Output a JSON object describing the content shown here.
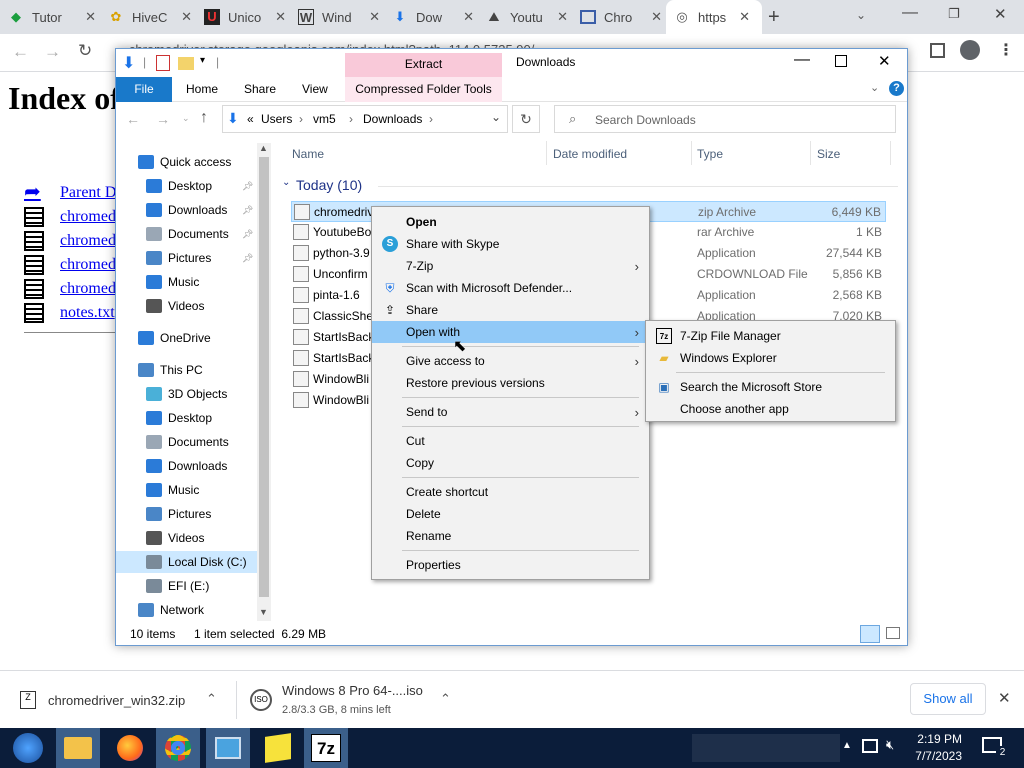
{
  "browser": {
    "tabs": [
      {
        "title": "Tutor",
        "icon": "tutorialspoint-icon"
      },
      {
        "title": "HiveC",
        "icon": "hive-icon"
      },
      {
        "title": "Unico",
        "icon": "unicode-icon"
      },
      {
        "title": "Wind",
        "icon": "wikipedia-icon"
      },
      {
        "title": "Dow",
        "icon": "download-icon"
      },
      {
        "title": "Youtu",
        "icon": "youtube-downloader-icon"
      },
      {
        "title": "Chro",
        "icon": "chrome-window-icon"
      },
      {
        "title": "https",
        "icon": "globe-icon"
      }
    ],
    "address_url": "...chromedriver.storage.googleapis.com/index.html?path=114.0.5735.90/"
  },
  "page": {
    "heading": "Index of",
    "links": [
      "Parent D",
      "chromed",
      "chromed",
      "chromed",
      "chromed",
      "notes.txt"
    ]
  },
  "explorer": {
    "title": "Downloads",
    "ribbon": {
      "extract_tab": "Extract",
      "tabs": [
        "File",
        "Home",
        "Share",
        "View",
        "Compressed Folder Tools"
      ]
    },
    "breadcrumb": [
      "«",
      "Users",
      "vm5",
      "Downloads"
    ],
    "search_placeholder": "Search Downloads",
    "columns": [
      "Name",
      "Date modified",
      "Type",
      "Size"
    ],
    "group_label": "Today (10)",
    "nav": [
      {
        "label": "Quick access",
        "icon": "star-icon",
        "color": "#2b7bd8",
        "indent": 1,
        "pinned": false
      },
      {
        "label": "Desktop",
        "icon": "desktop-icon",
        "color": "#2b7bd8",
        "indent": 2,
        "pinned": true
      },
      {
        "label": "Downloads",
        "icon": "downloads-icon",
        "color": "#2b7bd8",
        "indent": 2,
        "pinned": true
      },
      {
        "label": "Documents",
        "icon": "documents-icon",
        "color": "#9aa7b5",
        "indent": 2,
        "pinned": true
      },
      {
        "label": "Pictures",
        "icon": "pictures-icon",
        "color": "#4a86c7",
        "indent": 2,
        "pinned": true
      },
      {
        "label": "Music",
        "icon": "music-icon",
        "color": "#2b7bd8",
        "indent": 2,
        "pinned": false
      },
      {
        "label": "Videos",
        "icon": "videos-icon",
        "color": "#555555",
        "indent": 2,
        "pinned": false
      },
      {
        "label": "OneDrive",
        "icon": "onedrive-icon",
        "color": "#2b7bd8",
        "indent": 1,
        "pinned": false
      },
      {
        "label": "This PC",
        "icon": "this-pc-icon",
        "color": "#4a86c7",
        "indent": 1,
        "pinned": false
      },
      {
        "label": "3D Objects",
        "icon": "3d-objects-icon",
        "color": "#4ab0d8",
        "indent": 2,
        "pinned": false
      },
      {
        "label": "Desktop",
        "icon": "desktop-icon",
        "color": "#2b7bd8",
        "indent": 2,
        "pinned": false
      },
      {
        "label": "Documents",
        "icon": "documents-icon",
        "color": "#9aa7b5",
        "indent": 2,
        "pinned": false
      },
      {
        "label": "Downloads",
        "icon": "downloads-icon",
        "color": "#2b7bd8",
        "indent": 2,
        "pinned": false
      },
      {
        "label": "Music",
        "icon": "music-icon",
        "color": "#2b7bd8",
        "indent": 2,
        "pinned": false
      },
      {
        "label": "Pictures",
        "icon": "pictures-icon",
        "color": "#4a86c7",
        "indent": 2,
        "pinned": false
      },
      {
        "label": "Videos",
        "icon": "videos-icon",
        "color": "#555555",
        "indent": 2,
        "pinned": false
      },
      {
        "label": "Local Disk (C:)",
        "icon": "drive-icon",
        "color": "#7a8a99",
        "indent": 2,
        "pinned": false,
        "selected": true
      },
      {
        "label": "EFI (E:)",
        "icon": "drive-icon",
        "color": "#7a8a99",
        "indent": 2,
        "pinned": false
      },
      {
        "label": "Network",
        "icon": "network-icon",
        "color": "#4a86c7",
        "indent": 1,
        "pinned": false
      }
    ],
    "files": [
      {
        "name": "chromedriver_win32.zip",
        "type": "zip Archive",
        "size": "6,449 KB",
        "selected": true,
        "icon": "zip-icon"
      },
      {
        "name": "YoutubeBo",
        "type": "rar Archive",
        "size": "1 KB",
        "icon": "rar-icon"
      },
      {
        "name": "python-3.9",
        "type": "Application",
        "size": "27,544 KB",
        "icon": "python-icon"
      },
      {
        "name": "Unconfirm",
        "type": "CRDOWNLOAD File",
        "size": "5,856 KB",
        "icon": "blank-file-icon"
      },
      {
        "name": "pinta-1.6",
        "type": "Application",
        "size": "2,568 KB",
        "icon": "pinta-icon"
      },
      {
        "name": "ClassicShel",
        "type": "Application",
        "size": "7,020 KB",
        "icon": "shell-icon"
      },
      {
        "name": "StartIsBack",
        "type": "",
        "size": "",
        "icon": "setup-icon"
      },
      {
        "name": "StartIsBack",
        "type": "",
        "size": "",
        "icon": "setup-icon"
      },
      {
        "name": "WindowBli",
        "type": "",
        "size": "",
        "icon": "window-icon"
      },
      {
        "name": "WindowBli",
        "type": "",
        "size": "",
        "icon": "window-icon"
      }
    ],
    "status": {
      "items": "10 items",
      "selected": "1 item selected  6.29 MB"
    }
  },
  "context_menu": {
    "items": [
      {
        "label": "Open",
        "bold": true
      },
      {
        "label": "Share with Skype",
        "icon": "skype-icon"
      },
      {
        "label": "7-Zip",
        "arrow": true
      },
      {
        "label": "Scan with Microsoft Defender...",
        "icon": "defender-icon"
      },
      {
        "label": "Share",
        "icon": "share-icon"
      },
      {
        "label": "Open with",
        "arrow": true,
        "highlight": true
      },
      {
        "sep": true
      },
      {
        "label": "Give access to",
        "arrow": true
      },
      {
        "label": "Restore previous versions"
      },
      {
        "sep": true
      },
      {
        "label": "Send to",
        "arrow": true
      },
      {
        "sep": true
      },
      {
        "label": "Cut"
      },
      {
        "label": "Copy"
      },
      {
        "sep": true
      },
      {
        "label": "Create shortcut"
      },
      {
        "label": "Delete"
      },
      {
        "label": "Rename"
      },
      {
        "sep": true
      },
      {
        "label": "Properties"
      }
    ]
  },
  "submenu": {
    "items": [
      {
        "label": "7-Zip File Manager",
        "icon": "7zip-icon"
      },
      {
        "label": "Windows Explorer",
        "icon": "folder-icon"
      },
      {
        "sep": true
      },
      {
        "label": "Search the Microsoft Store",
        "icon": "store-icon"
      },
      {
        "label": "Choose another app"
      }
    ]
  },
  "downloads_bar": {
    "items": [
      {
        "name": "chromedriver_win32.zip",
        "sub": ""
      },
      {
        "name": "Windows 8 Pro 64-....iso",
        "sub": "2.8/3.3 GB, 8 mins left"
      }
    ],
    "show_all": "Show all"
  },
  "taskbar": {
    "time": "2:19 PM",
    "date": "7/7/2023",
    "notification_count": "2",
    "apps": [
      "start",
      "file-explorer",
      "firefox",
      "chrome",
      "control-panel",
      "sticky",
      "7zip"
    ]
  },
  "colors": {
    "accent": "#0078d7",
    "selection": "#cce8ff",
    "ribbon_extract": "#f9c9d9",
    "taskbar": "#0b1d3a"
  }
}
